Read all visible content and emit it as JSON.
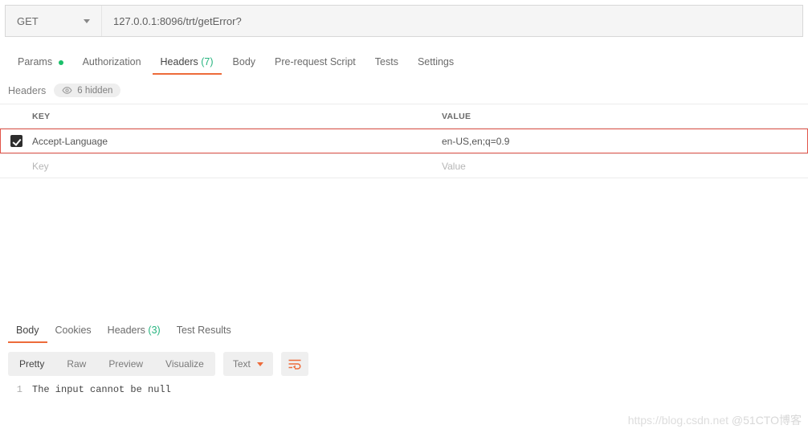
{
  "request": {
    "method": "GET",
    "url": "127.0.0.1:8096/trt/getError?"
  },
  "request_tabs": {
    "params": "Params",
    "authorization": "Authorization",
    "headers_label": "Headers",
    "headers_count": "(7)",
    "body": "Body",
    "prerequest": "Pre-request Script",
    "tests": "Tests",
    "settings": "Settings"
  },
  "headers_section": {
    "title": "Headers",
    "hidden_label": "6 hidden",
    "columns": {
      "key": "KEY",
      "value": "VALUE"
    },
    "rows": [
      {
        "key": "Accept-Language",
        "value": "en-US,en;q=0.9",
        "checked": true
      }
    ],
    "placeholder": {
      "key": "Key",
      "value": "Value"
    }
  },
  "response_tabs": {
    "body": "Body",
    "cookies": "Cookies",
    "headers_label": "Headers",
    "headers_count": "(3)",
    "test_results": "Test Results"
  },
  "response_toolbar": {
    "pretty": "Pretty",
    "raw": "Raw",
    "preview": "Preview",
    "visualize": "Visualize",
    "mode": "Text"
  },
  "response_body": {
    "line_number": "1",
    "text": "The input cannot be null"
  },
  "watermark": {
    "left": "https://blog.csdn.net",
    "right": "@51CTO博客"
  }
}
